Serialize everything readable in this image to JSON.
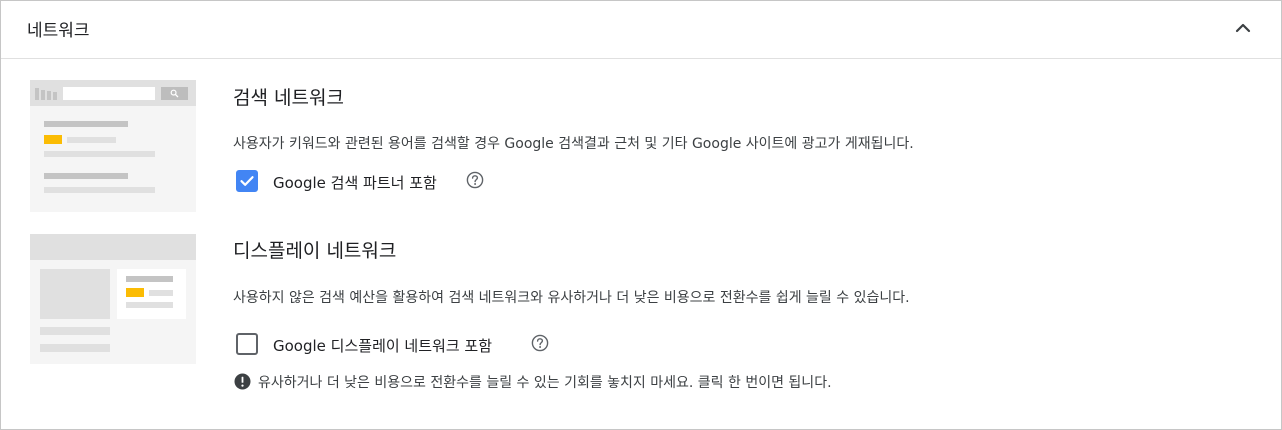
{
  "header": {
    "title": "네트워크",
    "collapse_icon": "chevron-up-icon"
  },
  "search_network": {
    "title": "검색 네트워크",
    "description": "사용자가 키워드와 관련된 용어를 검색할 경우 Google 검색결과 근처 및 기타 Google 사이트에 광고가 게재됩니다.",
    "checkbox": {
      "label": "Google 검색 파트너 포함",
      "checked": true
    },
    "help_icon": "help-circle-icon"
  },
  "display_network": {
    "title": "디스플레이 네트워크",
    "description": "사용하지 않은 검색 예산을 활용하여 검색 네트워크와 유사하거나 더 낮은 비용으로 전환수를 쉽게 늘릴 수 있습니다.",
    "checkbox": {
      "label": "Google 디스플레이 네트워크 포함",
      "checked": false
    },
    "help_icon": "help-circle-icon",
    "warning": {
      "icon": "error-icon",
      "text": "유사하거나 더 낮은 비용으로 전환수를 늘릴 수 있는 기회를 놓치지 마세요. 클릭 한 번이면 됩니다."
    }
  },
  "colors": {
    "accent": "#4285f4",
    "illustration_highlight": "#fbbc04",
    "illustration_bg": "#f5f5f5",
    "border": "#c6c6c6"
  }
}
